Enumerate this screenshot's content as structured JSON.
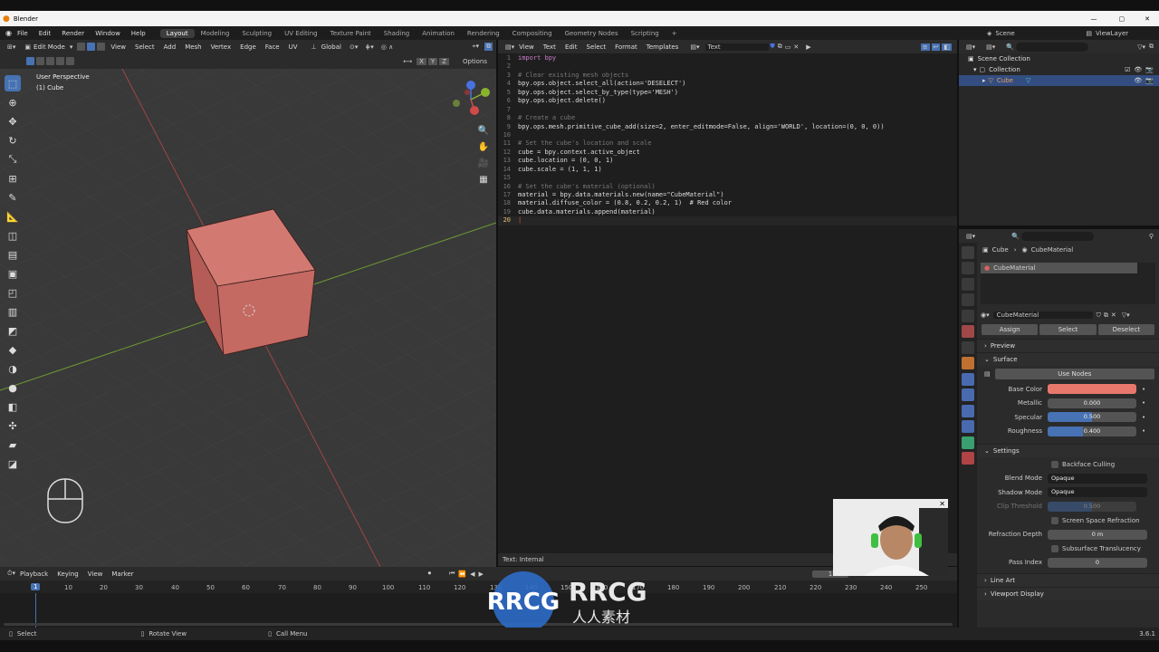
{
  "window": {
    "app_title": "Blender"
  },
  "menubar": {
    "menus": [
      "File",
      "Edit",
      "Render",
      "Window",
      "Help"
    ],
    "workspaces": [
      "Layout",
      "Modeling",
      "Sculpting",
      "UV Editing",
      "Texture Paint",
      "Shading",
      "Animation",
      "Rendering",
      "Compositing",
      "Geometry Nodes",
      "Scripting"
    ],
    "active_workspace": "Layout",
    "scene": "Scene",
    "view_layer": "ViewLayer"
  },
  "viewport": {
    "mode": "Edit Mode",
    "menus": [
      "View",
      "Select",
      "Add",
      "Mesh",
      "Vertex",
      "Edge",
      "Face",
      "UV"
    ],
    "orientation": "Global",
    "options_label": "Options",
    "axes": [
      "X",
      "Y",
      "Z"
    ],
    "overlay_title": "User Perspective",
    "overlay_subtitle": "(1) Cube"
  },
  "text_editor": {
    "menus": [
      "View",
      "Text",
      "Edit",
      "Select",
      "Format",
      "Templates"
    ],
    "text_name": "Text",
    "footer": "Text: Internal",
    "lines": [
      {
        "n": "1",
        "code": "import bpy"
      },
      {
        "n": "2",
        "code": ""
      },
      {
        "n": "3",
        "code": "# Clear existing mesh objects"
      },
      {
        "n": "4",
        "code": "bpy.ops.object.select_all(action='DESELECT')"
      },
      {
        "n": "5",
        "code": "bpy.ops.object.select_by_type(type='MESH')"
      },
      {
        "n": "6",
        "code": "bpy.ops.object.delete()"
      },
      {
        "n": "7",
        "code": ""
      },
      {
        "n": "8",
        "code": "# Create a cube"
      },
      {
        "n": "9",
        "code": "bpy.ops.mesh.primitive_cube_add(size=2, enter_editmode=False, align='WORLD', location=(0, 0, 0))"
      },
      {
        "n": "10",
        "code": ""
      },
      {
        "n": "11",
        "code": "# Set the cube's location and scale"
      },
      {
        "n": "12",
        "code": "cube = bpy.context.active_object"
      },
      {
        "n": "13",
        "code": "cube.location = (0, 0, 1)"
      },
      {
        "n": "14",
        "code": "cube.scale = (1, 1, 1)"
      },
      {
        "n": "15",
        "code": ""
      },
      {
        "n": "16",
        "code": "# Set the cube's material (optional)"
      },
      {
        "n": "17",
        "code": "material = bpy.data.materials.new(name=\"CubeMaterial\")"
      },
      {
        "n": "18",
        "code": "material.diffuse_color = (0.8, 0.2, 0.2, 1)  # Red color"
      },
      {
        "n": "19",
        "code": "cube.data.materials.append(material)"
      },
      {
        "n": "20",
        "code": ""
      }
    ]
  },
  "outliner": {
    "root": "Scene Collection",
    "collection": "Collection",
    "object": "Cube"
  },
  "properties": {
    "breadcrumb_object": "Cube",
    "breadcrumb_material": "CubeMaterial",
    "slot_name": "CubeMaterial",
    "material_name": "CubeMaterial",
    "assign": "Assign",
    "select": "Select",
    "deselect": "Deselect",
    "preview": "Preview",
    "surface": "Surface",
    "use_nodes": "Use Nodes",
    "base_color_label": "Base Color",
    "base_color": "#e8776c",
    "metallic_label": "Metallic",
    "metallic": "0.000",
    "specular_label": "Specular",
    "specular": "0.500",
    "roughness_label": "Roughness",
    "roughness": "0.400",
    "settings": "Settings",
    "backface_culling": "Backface Culling",
    "blend_mode_label": "Blend Mode",
    "blend_mode": "Opaque",
    "shadow_mode_label": "Shadow Mode",
    "shadow_mode": "Opaque",
    "clip_threshold_label": "Clip Threshold",
    "clip_threshold": "0.500",
    "screen_space_refraction": "Screen Space Refraction",
    "refraction_depth_label": "Refraction Depth",
    "refraction_depth": "0 m",
    "subsurface_translucency": "Subsurface Translucency",
    "pass_index_label": "Pass Index",
    "pass_index": "0",
    "line_art": "Line Art",
    "viewport_display": "Viewport Display"
  },
  "timeline": {
    "menus": [
      "Playback",
      "Keying",
      "View",
      "Marker"
    ],
    "current_frame": "1",
    "ticks": [
      "1",
      "10",
      "20",
      "30",
      "40",
      "50",
      "60",
      "70",
      "80",
      "90",
      "100",
      "110",
      "120",
      "130",
      "140",
      "150",
      "160",
      "170",
      "180",
      "190",
      "200",
      "210",
      "220",
      "230",
      "240",
      "250"
    ]
  },
  "statusbar": {
    "select": "Select",
    "rotate_view": "Rotate View",
    "call_menu": "Call Menu",
    "version": "3.6.1"
  },
  "watermark": {
    "brand": "RRCG",
    "subtitle": "人人素材"
  }
}
